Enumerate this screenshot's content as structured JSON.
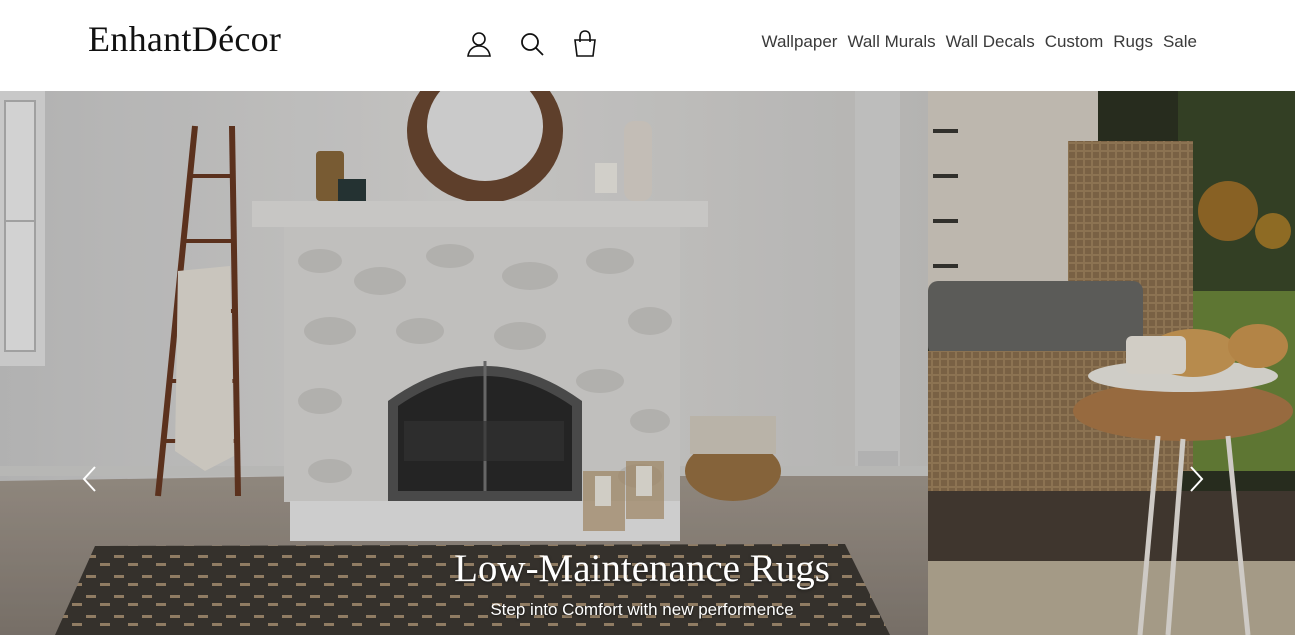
{
  "header": {
    "logo": "EnhantDécor",
    "icons": [
      "account-icon",
      "search-icon",
      "shopping-bag-icon"
    ],
    "nav": [
      "Wallpaper",
      "Wall Murals",
      "Wall Decals",
      "Custom",
      "Rugs",
      "Sale"
    ]
  },
  "hero": {
    "title": "Low-Maintenance Rugs",
    "subtitle": "Step into Comfort with new performence",
    "prev_icon": "chevron-left-icon",
    "next_icon": "chevron-right-icon"
  },
  "colors": {
    "text": "#3a3a3a",
    "logo": "#111111",
    "overlay_text": "#ffffff"
  }
}
